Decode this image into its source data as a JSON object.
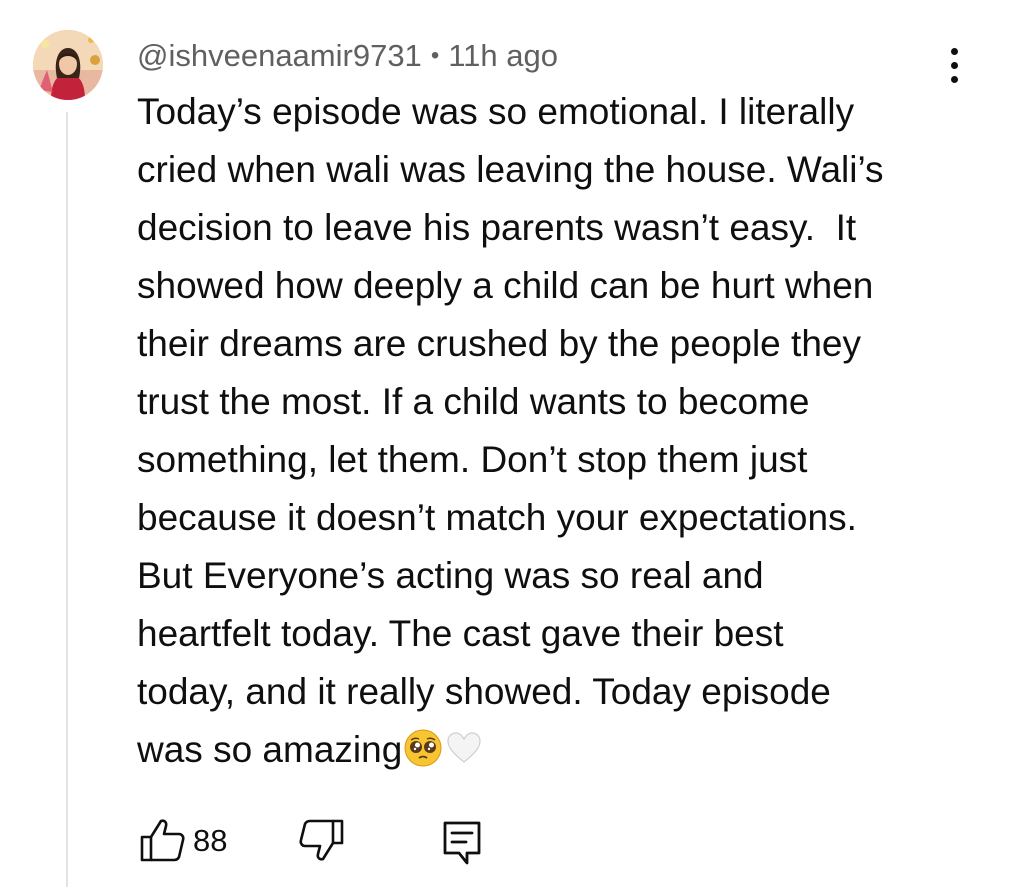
{
  "comment": {
    "author": "@ishveenaamir9731",
    "separator": "•",
    "timestamp": "11h ago",
    "text_lines": [
      "Today’s episode was so emotional. I literally",
      "cried when wali was leaving the house. Wali’s",
      "decision to leave his parents wasn’t easy.  It",
      "showed how deeply a child can be hurt when",
      "their dreams are crushed by the people they",
      "trust the most. If a child wants to become",
      "something, let them. Don’t stop them just",
      "because it doesn’t match your expectations.",
      "But Everyone’s acting was so real and",
      "heartfelt today. The cast gave their best",
      "today, and it really showed. Today episode",
      "was so amazing"
    ],
    "trailing_emojis": [
      "pleading-face-emoji",
      "white-heart-emoji"
    ],
    "avatar": "user-avatar-photo"
  },
  "actions": {
    "like_count": "88",
    "like_icon": "thumbs-up-icon",
    "dislike_icon": "thumbs-down-icon",
    "reply_icon": "reply-comment-icon"
  },
  "menu": {
    "icon": "more-vertical-icon"
  },
  "colors": {
    "text": "#0f0f0f",
    "meta_text": "#606060",
    "thread_line": "#e3e3e3",
    "background": "#ffffff"
  }
}
